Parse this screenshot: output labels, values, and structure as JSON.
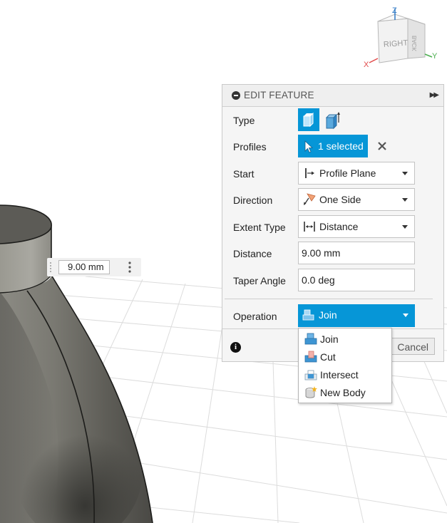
{
  "viewcube": {
    "face_label": "RIGHT",
    "side_label": "BACK",
    "axis_x": "X",
    "axis_y": "Y",
    "axis_z": "Z"
  },
  "dimension_input": {
    "value": "9.00 mm"
  },
  "panel": {
    "title": "EDIT FEATURE",
    "rows": {
      "type": {
        "label": "Type"
      },
      "profiles": {
        "label": "Profiles",
        "value": "1 selected"
      },
      "start": {
        "label": "Start",
        "value": "Profile Plane"
      },
      "direction": {
        "label": "Direction",
        "value": "One Side"
      },
      "extent_type": {
        "label": "Extent Type",
        "value": "Distance"
      },
      "distance": {
        "label": "Distance",
        "value": "9.00 mm"
      },
      "taper_angle": {
        "label": "Taper Angle",
        "value": "0.0 deg"
      },
      "operation": {
        "label": "Operation",
        "value": "Join"
      }
    },
    "footer": {
      "cancel_label": "Cancel"
    }
  },
  "operation_menu": {
    "items": [
      {
        "label": "Join",
        "icon": "join-icon"
      },
      {
        "label": "Cut",
        "icon": "cut-icon"
      },
      {
        "label": "Intersect",
        "icon": "intersect-icon"
      },
      {
        "label": "New Body",
        "icon": "new-body-icon"
      }
    ]
  },
  "colors": {
    "accent": "#0696d7",
    "panel_bg": "#f5f5f5",
    "body_dark": "#5f5e58",
    "grid": "#d6d6d6"
  }
}
